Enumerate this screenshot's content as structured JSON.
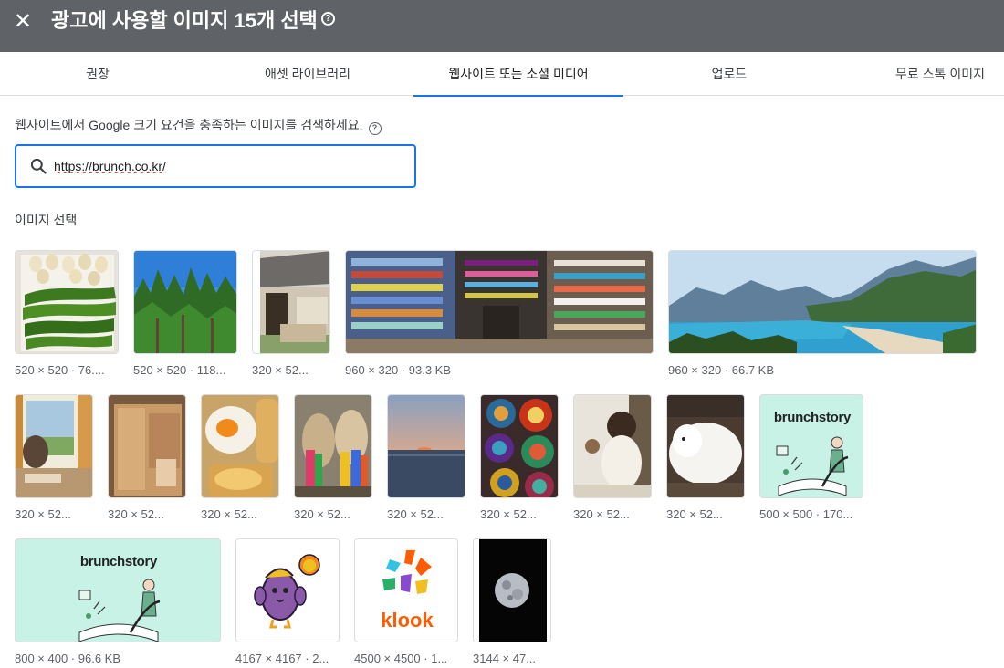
{
  "header": {
    "title": "광고에 사용할 이미지 15개 선택",
    "close_icon": "close-icon",
    "help_icon": "help-icon"
  },
  "tabs": [
    {
      "label": "권장"
    },
    {
      "label": "애셋 라이브러리"
    },
    {
      "label": "웹사이트 또는 소셜 미디어",
      "active": true
    },
    {
      "label": "업로드"
    },
    {
      "label": "무료 스톡 이미지"
    }
  ],
  "search": {
    "description": "웹사이트에서 Google 크기 요건을 충족하는 이미지를 검색하세요.",
    "value": "https://brunch.co.kr/",
    "icon": "search-icon"
  },
  "section_label": "이미지 선택",
  "images": [
    {
      "caption": "520 × 520 · 76....",
      "subject": "green peppers and garlic"
    },
    {
      "caption": "520 × 520 · 118...",
      "subject": "pine trees and sky"
    },
    {
      "caption": "320 × 52...",
      "subject": "house with roof"
    },
    {
      "caption": "960 × 320 · 93.3 KB",
      "subject": "crowded shop shelves"
    },
    {
      "caption": "960 × 320 · 66.7 KB",
      "subject": "mountain lagoon beach"
    },
    {
      "caption": "320 × 52...",
      "subject": "cat by window"
    },
    {
      "caption": "320 × 52...",
      "subject": "cardboard box"
    },
    {
      "caption": "320 × 52...",
      "subject": "fried eggs"
    },
    {
      "caption": "320 × 52...",
      "subject": "alpacas with tassels"
    },
    {
      "caption": "320 × 52...",
      "subject": "sunset over sea"
    },
    {
      "caption": "320 × 52...",
      "subject": "ceramic bowls"
    },
    {
      "caption": "320 × 52...",
      "subject": "child playing"
    },
    {
      "caption": "320 × 52...",
      "subject": "white dog"
    },
    {
      "caption": "500 × 500 · 170...",
      "subject": "brunchstory logo square",
      "logo_text": "brunchstory"
    },
    {
      "caption": "800 × 400 · 96.6 KB",
      "subject": "brunchstory logo wide",
      "logo_text": "brunchstory"
    },
    {
      "caption": "4167 × 4167 · 2...",
      "subject": "purple character"
    },
    {
      "caption": "4500 × 4500 · 1...",
      "subject": "klook logo",
      "logo_text": "klook"
    },
    {
      "caption": "3144 × 47...",
      "subject": "full moon"
    }
  ],
  "colors": {
    "header_bg": "#5f6368",
    "accent": "#1a73e8",
    "brunch_bg": "#c8f2e6",
    "klook_orange": "#ff5b00"
  }
}
